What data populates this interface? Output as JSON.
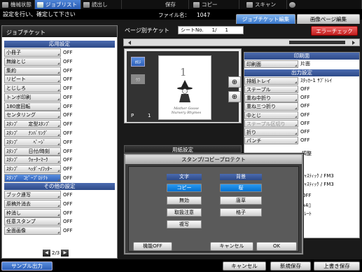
{
  "topbar": {
    "tabs": [
      {
        "label": "機械状態",
        "active": false
      },
      {
        "label": "ジョブリスト",
        "active": true
      },
      {
        "label": "読出し",
        "active": false
      },
      {
        "label": "保存",
        "active": false
      },
      {
        "label": "コピー",
        "active": false
      },
      {
        "label": "スキャン",
        "active": false
      },
      {
        "label": "",
        "active": false
      }
    ]
  },
  "status": {
    "message": "設定を行い、確定して下さい",
    "file_label": "ファイル名：",
    "file_name": "1047"
  },
  "right_tabs": {
    "job_ticket_edit": "ジョブチケット編集",
    "image_page_edit": "画像ページ編集"
  },
  "left_panel": {
    "title": "ジョブチケット",
    "section_apply": "応用設定",
    "rows": [
      {
        "label": "小冊子",
        "value": "OFF"
      },
      {
        "label": "無線とじ",
        "value": "OFF"
      },
      {
        "label": "集約",
        "value": "OFF"
      },
      {
        "label": "リピート",
        "value": "OFF"
      },
      {
        "label": "とじしろ",
        "value": "OFF"
      },
      {
        "label": "トンボ印刷",
        "value": "OFF"
      },
      {
        "label": "180度回転",
        "value": "OFF"
      },
      {
        "label": "センタリング",
        "value": "OFF"
      },
      {
        "label": "ｽﾀﾝﾌﾟ　　定型ｽﾀﾝﾌﾟ",
        "value": "OFF"
      },
      {
        "label": "ｽﾀﾝﾌﾟ　　ﾅﾝﾊﾞﾘﾝｸﾞ",
        "value": "OFF"
      },
      {
        "label": "ｽﾀﾝﾌﾟ　　　ﾍﾟｰｼﾞ",
        "value": "OFF"
      },
      {
        "label": "ｽﾀﾝﾌﾟ　　日付/時刻",
        "value": "OFF"
      },
      {
        "label": "ｽﾀﾝﾌﾟ　　ｳｫｰﾀｰﾏｰｸ",
        "value": "OFF"
      },
      {
        "label": "ｽﾀﾝﾌﾟ　　ﾍｯﾀﾞｰ/ﾌｯﾀｰ",
        "value": "OFF"
      },
      {
        "label": "ｽﾀﾝﾌﾟ　ｺﾋﾟｰﾌﾟﾛﾃｸﾄ",
        "value": "OFF",
        "selected": true
      }
    ],
    "section_other": "その他の設定",
    "other_rows": [
      {
        "label": "ブック連写",
        "value": "OFF"
      },
      {
        "label": "原稿外消去",
        "value": "OFF"
      },
      {
        "label": "枠消し",
        "value": "OFF"
      },
      {
        "label": "任意スタンプ",
        "value": "OFF"
      },
      {
        "label": "全面画像",
        "value": "OFF"
      }
    ],
    "pager": "2/3"
  },
  "center": {
    "page_ticket_title": "ページ別チケット",
    "sheet_label": "シートNo.",
    "sheet_value": "1/",
    "sheet_total": "1",
    "error_check": "エラーチェック",
    "preview_tab1": "ｵﾓﾃ",
    "preview_tab2": "ｳﾗ",
    "page_number": "1",
    "preview_text": "Mother Goose\nNursery Rhymes",
    "p_label": "P",
    "p_number": "1",
    "paper_section": "用紙設定"
  },
  "right_panel": {
    "section_print": "印刷面",
    "print_face": {
      "label": "印刷面",
      "value": "片面"
    },
    "section_output": "出力設定",
    "rows": [
      {
        "label": "排紙トレイ",
        "value": "ｽﾀｯｶｰ1 ｻﾌﾞﾄﾚｲ"
      },
      {
        "label": "ステープル",
        "value": "OFF"
      },
      {
        "label": "重ね中折り",
        "value": "OFF"
      },
      {
        "label": "重ね三つ折り",
        "value": "OFF"
      },
      {
        "label": "中とじ",
        "value": "OFF"
      },
      {
        "label": "ステープル区切り",
        "value": "OFF",
        "disabled": true
      },
      {
        "label": "折り",
        "value": "OFF"
      },
      {
        "label": "パンチ",
        "value": "OFF"
      }
    ],
    "hidden_values": [
      "調整",
      "ｷｬｽﾃｨｯｸ / FM3",
      "ｷｬｽﾃｨｯｸ / FM3",
      "OFF",
      "A4▯",
      "ﾄﾚｰﾄ"
    ]
  },
  "dialog": {
    "title": "スタンプ/コピープロテクト",
    "col_text": "文字",
    "col_back": "背景",
    "text_options": [
      "コピー",
      "無効",
      "取扱注意",
      "複写"
    ],
    "back_options": [
      "桜",
      "唐草",
      "格子"
    ],
    "func_off": "機能OFF",
    "cancel": "キャンセル",
    "ok": "OK"
  },
  "bottom": {
    "sample": "サンプル出力",
    "cancel": "キャンセル",
    "new_save": "新規保存",
    "overwrite_save": "上書き保存"
  }
}
